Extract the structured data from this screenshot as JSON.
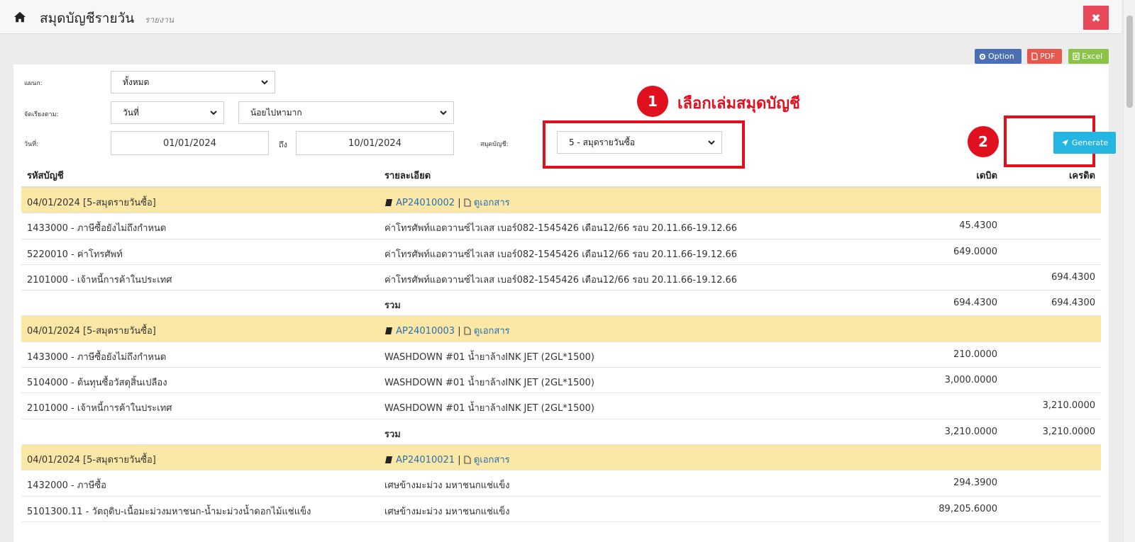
{
  "header": {
    "title": "สมุดบัญชีรายวัน",
    "subtitle": "รายงาน",
    "close_label": "✖"
  },
  "actions": {
    "option_label": "Option",
    "pdf_label": "PDF",
    "excel_label": "Excel"
  },
  "filters": {
    "department_label": "แผนก:",
    "department_value": "ทั้งหมด",
    "sort_label": "จัดเรียงตาม:",
    "sort_field_value": "วันที่",
    "sort_order_value": "น้อยไปหามาก",
    "date_label": "วันที่:",
    "date_from": "01/01/2024",
    "to_label": "ถึง",
    "date_to": "10/01/2024",
    "journal_label": "สมุดบัญชี:",
    "journal_value": "5 - สมุดรายวันซื้อ",
    "generate_label": "Generate"
  },
  "annotations": {
    "step1_number": "1",
    "step1_text": "เลือกเล่มสมุดบัญชี",
    "step2_number": "2"
  },
  "colors": {
    "annotation_red": "#e0101e",
    "group_row_bg": "#fbe8a6",
    "generate_bg": "#25b5e3",
    "link": "#2a6fb0"
  },
  "table": {
    "headers": {
      "account": "รหัสบัญชี",
      "description": "รายละเอียด",
      "debit": "เดบิต",
      "credit": "เครดิต"
    },
    "doc_separator": "|",
    "view_doc_label": "ดูเอกสาร",
    "total_label": "รวม",
    "groups": [
      {
        "date_journal": "04/01/2024  [5-สมุดรายวันซื้อ]",
        "doc_no": "AP24010002",
        "rows": [
          {
            "account": "1433000 - ภาษีซื้อยังไม่ถึงกำหนด",
            "description": "ค่าโทรศัพท์แอดวานซ์ไวเลส เบอร์082-1545426 เดือน12/66 รอบ 20.11.66-19.12.66",
            "debit": "45.4300",
            "credit": ""
          },
          {
            "account": "5220010 - ค่าโทรศัพท์",
            "description": "ค่าโทรศัพท์แอดวานซ์ไวเลส เบอร์082-1545426 เดือน12/66 รอบ 20.11.66-19.12.66",
            "debit": "649.0000",
            "credit": ""
          },
          {
            "account": "2101000 - เจ้าหนี้การค้าในประเทศ",
            "description": "ค่าโทรศัพท์แอดวานซ์ไวเลส เบอร์082-1545426 เดือน12/66 รอบ 20.11.66-19.12.66",
            "debit": "",
            "credit": "694.4300"
          }
        ],
        "total_debit": "694.4300",
        "total_credit": "694.4300"
      },
      {
        "date_journal": "04/01/2024  [5-สมุดรายวันซื้อ]",
        "doc_no": "AP24010003",
        "rows": [
          {
            "account": "1433000 - ภาษีซื้อยังไม่ถึงกำหนด",
            "description": "WASHDOWN #01 น้ำยาล้างINK JET (2GL*1500)",
            "debit": "210.0000",
            "credit": ""
          },
          {
            "account": "5104000 - ต้นทุนซื้อวัสดุสิ้นเปลือง",
            "description": "WASHDOWN #01 น้ำยาล้างINK JET (2GL*1500)",
            "debit": "3,000.0000",
            "credit": ""
          },
          {
            "account": "2101000 - เจ้าหนี้การค้าในประเทศ",
            "description": "WASHDOWN #01 น้ำยาล้างINK JET (2GL*1500)",
            "debit": "",
            "credit": "3,210.0000"
          }
        ],
        "total_debit": "3,210.0000",
        "total_credit": "3,210.0000"
      },
      {
        "date_journal": "04/01/2024  [5-สมุดรายวันซื้อ]",
        "doc_no": "AP24010021",
        "rows": [
          {
            "account": "1432000 - ภาษีซื้อ",
            "description": "เศษข้างมะม่วง มหาชนกแช่แข็ง",
            "debit": "294.3900",
            "credit": ""
          },
          {
            "account": "5101300.11 - วัตถุดิบ-เนื้อมะม่วงมหาชนก-น้ำมะม่วงน้ำดอกไม้แช่แข็ง",
            "description": "เศษข้างมะม่วง มหาชนกแช่แข็ง",
            "debit": "89,205.6000",
            "credit": ""
          }
        ]
      }
    ]
  }
}
